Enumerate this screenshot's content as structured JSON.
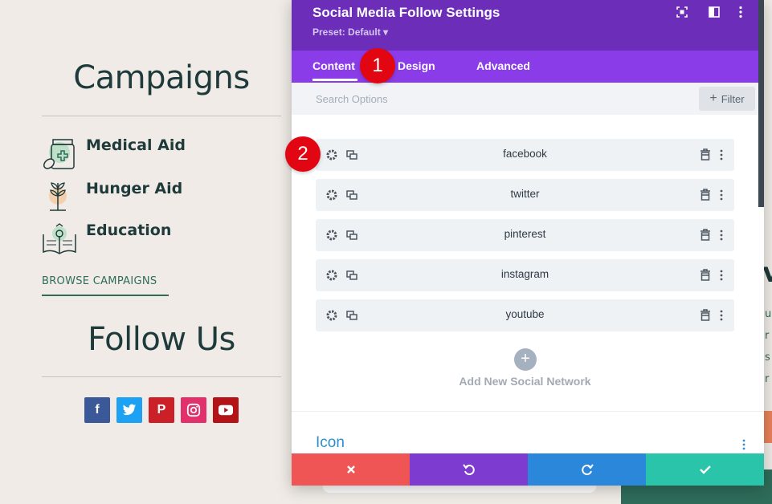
{
  "page": {
    "campaigns_heading": "Campaigns",
    "campaigns": [
      {
        "label": "Medical Aid",
        "icon": "medicine-bottle-icon"
      },
      {
        "label": "Hunger Aid",
        "icon": "plant-sprout-icon"
      },
      {
        "label": "Education",
        "icon": "open-book-icon"
      }
    ],
    "browse_link": "BROWSE CAMPAIGNS",
    "follow_heading": "Follow Us",
    "social_icons": [
      {
        "name": "facebook",
        "glyph": "f",
        "color": "#3b5998"
      },
      {
        "name": "twitter",
        "glyph": "t",
        "color": "#1da1f2"
      },
      {
        "name": "pinterest",
        "glyph": "P",
        "color": "#cb2027"
      },
      {
        "name": "instagram",
        "glyph": "◎",
        "color": "#e1306c"
      },
      {
        "name": "youtube",
        "glyph": "▶",
        "color": "#b31217"
      }
    ]
  },
  "modal": {
    "title": "Social Media Follow Settings",
    "preset": "Preset: Default ▾",
    "tabs": [
      "Content",
      "Design",
      "Advanced"
    ],
    "active_tab": "Content",
    "search_placeholder": "Search Options",
    "filter_label": "Filter",
    "networks": [
      "facebook",
      "twitter",
      "pinterest",
      "instagram",
      "youtube"
    ],
    "add_network_label": "Add New Social Network",
    "icon_section": "Icon",
    "colors": {
      "header": "#6c2eb9",
      "tabs": "#8a3ce8",
      "cancel": "#ef5555",
      "undo": "#7e3bd0",
      "redo": "#2b87da",
      "save": "#29c4a9"
    }
  },
  "badges": [
    "1",
    "2"
  ]
}
